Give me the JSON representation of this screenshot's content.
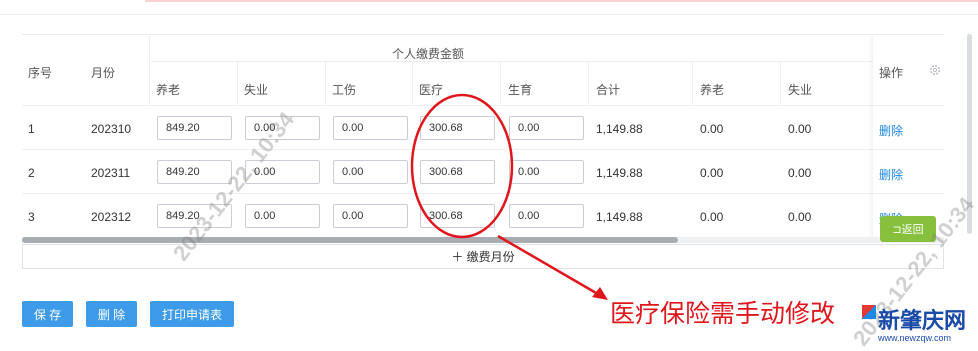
{
  "table": {
    "group_header": "个人缴费金额",
    "headers": {
      "seq": "序号",
      "month": "月份",
      "pension": "养老",
      "unemployment": "失业",
      "injury": "工伤",
      "medical": "医疗",
      "maternity": "生育",
      "total": "合计",
      "pension2": "养老",
      "unemployment2": "失业",
      "action": "操作"
    },
    "rows": [
      {
        "seq": "1",
        "month": "202310",
        "pension": "849.20",
        "unemployment": "0.00",
        "injury": "0.00",
        "medical": "300.68",
        "maternity": "0.00",
        "total": "1,149.88",
        "pension2": "0.00",
        "unemployment2": "0.00",
        "action": "删除"
      },
      {
        "seq": "2",
        "month": "202311",
        "pension": "849.20",
        "unemployment": "0.00",
        "injury": "0.00",
        "medical": "300.68",
        "maternity": "0.00",
        "total": "1,149.88",
        "pension2": "0.00",
        "unemployment2": "0.00",
        "action": "删除"
      },
      {
        "seq": "3",
        "month": "202312",
        "pension": "849.20",
        "unemployment": "0.00",
        "injury": "0.00",
        "medical": "300.68",
        "maternity": "0.00",
        "total": "1,149.88",
        "pension2": "0.00",
        "unemployment2": "0.00",
        "action": "删除"
      }
    ]
  },
  "add_month_label": "＋  缴费月份",
  "buttons": {
    "save": "保 存",
    "delete": "删 除",
    "print": "打印申请表",
    "back": "⊐返回"
  },
  "annotation": "医疗保险需手动修改",
  "watermark": "2023-12-22, 10:34",
  "logo": {
    "text": "新肇庆网",
    "url": "www.newzqw.com"
  },
  "colors": {
    "primary": "#3d9be9",
    "link": "#1e88e5",
    "annotation_red": "#e0161c",
    "back_green": "#87c03d"
  }
}
